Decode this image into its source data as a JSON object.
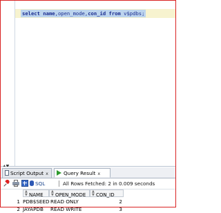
{
  "editor": {
    "sql": {
      "select_kw": "select",
      "name_col": "name",
      "comma1": ",",
      "open_mode_col": "open_mode",
      "comma2": ",",
      "con_id_col": "con_id",
      "from_kw": "from",
      "table": "v$pdbs;"
    }
  },
  "results": {
    "tabs": [
      {
        "label": "Script Output",
        "close": "x"
      },
      {
        "label": "Query Result",
        "close": "x"
      }
    ],
    "toolbar": {
      "sql_label": "SQL",
      "status": "All Rows Fetched: 2 in 0.009 seconds"
    },
    "columns": [
      "NAME",
      "OPEN_MODE",
      "CON_ID"
    ],
    "rows": [
      {
        "num": "1",
        "name": "PDB$SEED",
        "open_mode": "READ ONLY",
        "con_id": "2"
      },
      {
        "num": "2",
        "name": "JAYAPDB",
        "open_mode": "READ WRITE",
        "con_id": "3"
      }
    ]
  }
}
